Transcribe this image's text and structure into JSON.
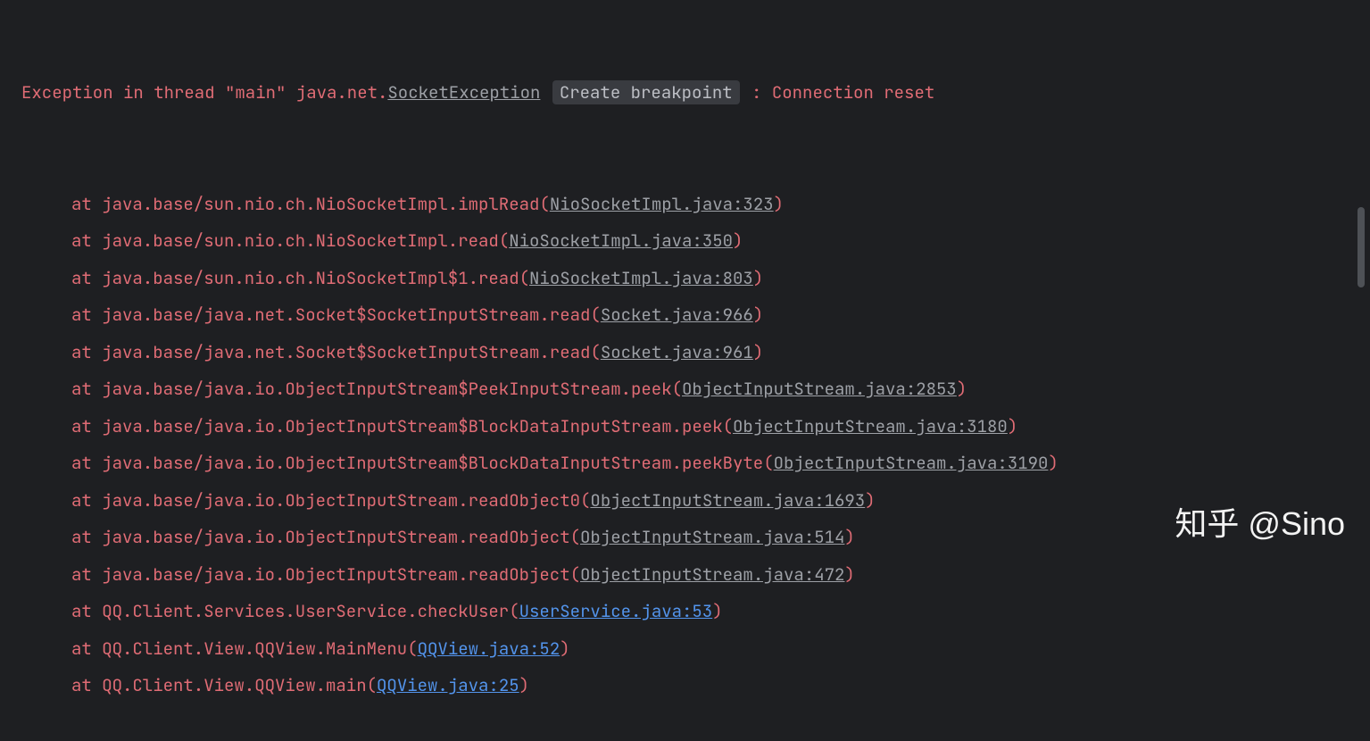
{
  "exception": {
    "prefix": "Exception in thread \"main\" java.net.",
    "name": "SocketException",
    "breakpoint_label": "Create breakpoint",
    "suffix": ": Connection reset"
  },
  "frames": [
    {
      "at": "at ",
      "loc": "java.base/sun.nio.ch.NioSocketImpl.implRead",
      "open": "(",
      "link": "NioSocketImpl.java:323",
      "close": ")",
      "type": "gray"
    },
    {
      "at": "at ",
      "loc": "java.base/sun.nio.ch.NioSocketImpl.read",
      "open": "(",
      "link": "NioSocketImpl.java:350",
      "close": ")",
      "type": "gray"
    },
    {
      "at": "at ",
      "loc": "java.base/sun.nio.ch.NioSocketImpl$1.read",
      "open": "(",
      "link": "NioSocketImpl.java:803",
      "close": ")",
      "type": "gray"
    },
    {
      "at": "at ",
      "loc": "java.base/java.net.Socket$SocketInputStream.read",
      "open": "(",
      "link": "Socket.java:966",
      "close": ")",
      "type": "gray"
    },
    {
      "at": "at ",
      "loc": "java.base/java.net.Socket$SocketInputStream.read",
      "open": "(",
      "link": "Socket.java:961",
      "close": ")",
      "type": "gray"
    },
    {
      "at": "at ",
      "loc": "java.base/java.io.ObjectInputStream$PeekInputStream.peek",
      "open": "(",
      "link": "ObjectInputStream.java:2853",
      "close": ")",
      "type": "gray"
    },
    {
      "at": "at ",
      "loc": "java.base/java.io.ObjectInputStream$BlockDataInputStream.peek",
      "open": "(",
      "link": "ObjectInputStream.java:3180",
      "close": ")",
      "type": "gray"
    },
    {
      "at": "at ",
      "loc": "java.base/java.io.ObjectInputStream$BlockDataInputStream.peekByte",
      "open": "(",
      "link": "ObjectInputStream.java:3190",
      "close": ")",
      "type": "gray"
    },
    {
      "at": "at ",
      "loc": "java.base/java.io.ObjectInputStream.readObject0",
      "open": "(",
      "link": "ObjectInputStream.java:1693",
      "close": ")",
      "type": "gray"
    },
    {
      "at": "at ",
      "loc": "java.base/java.io.ObjectInputStream.readObject",
      "open": "(",
      "link": "ObjectInputStream.java:514",
      "close": ")",
      "type": "gray"
    },
    {
      "at": "at ",
      "loc": "java.base/java.io.ObjectInputStream.readObject",
      "open": "(",
      "link": "ObjectInputStream.java:472",
      "close": ")",
      "type": "gray"
    },
    {
      "at": "at ",
      "loc": "QQ.Client.Services.UserService.checkUser",
      "open": "(",
      "link": "UserService.java:53",
      "close": ")",
      "type": "blue"
    },
    {
      "at": "at ",
      "loc": "QQ.Client.View.QQView.MainMenu",
      "open": "(",
      "link": "QQView.java:52",
      "close": ")",
      "type": "blue"
    },
    {
      "at": "at ",
      "loc": "QQ.Client.View.QQView.main",
      "open": "(",
      "link": "QQView.java:25",
      "close": ")",
      "type": "blue"
    }
  ],
  "watermark": "知乎 @Sino"
}
